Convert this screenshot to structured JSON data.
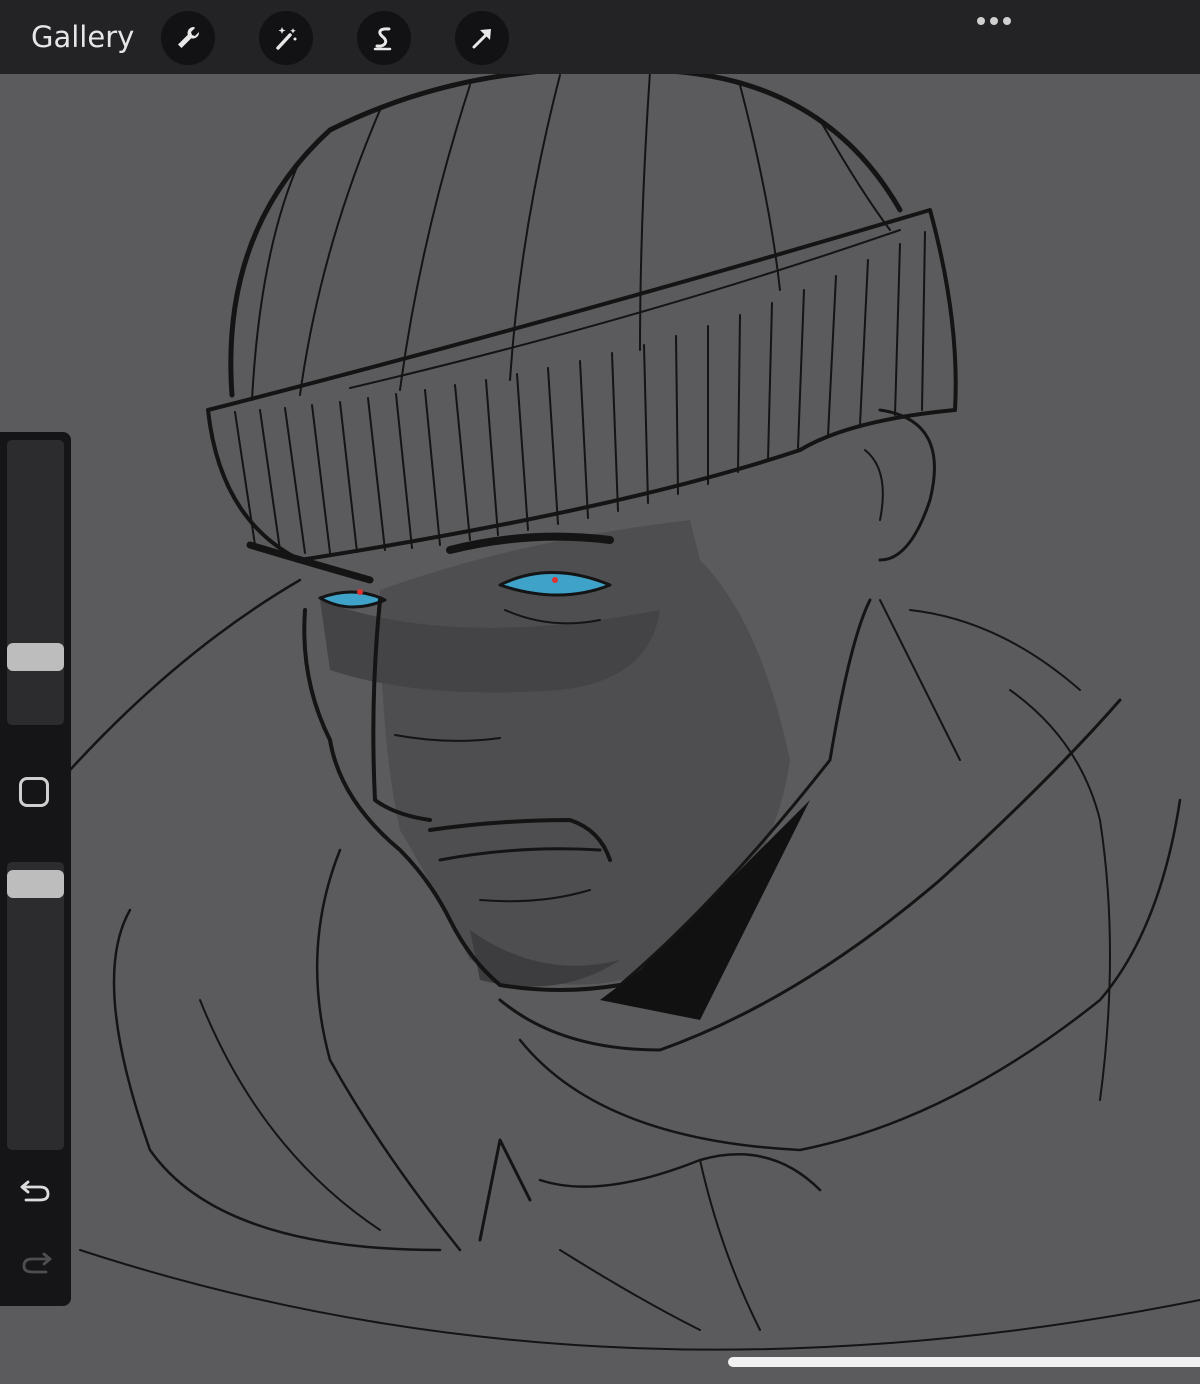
{
  "topbar": {
    "gallery_label": "Gallery",
    "tools": [
      "wrench-icon",
      "magic-wand-icon",
      "selection-icon",
      "transform-arrow-icon"
    ],
    "more_icon": "more-dots-icon"
  },
  "sidebar": {
    "brush_size_level": 0.21,
    "opacity_level": 0.97,
    "modifier_icon": "square-icon",
    "undo_icon": "undo-icon",
    "redo_icon": "redo-icon"
  },
  "canvas": {
    "content": "sketch-artwork",
    "background_color": "#5b5b5d",
    "eye_color": "#3fa3c9"
  }
}
